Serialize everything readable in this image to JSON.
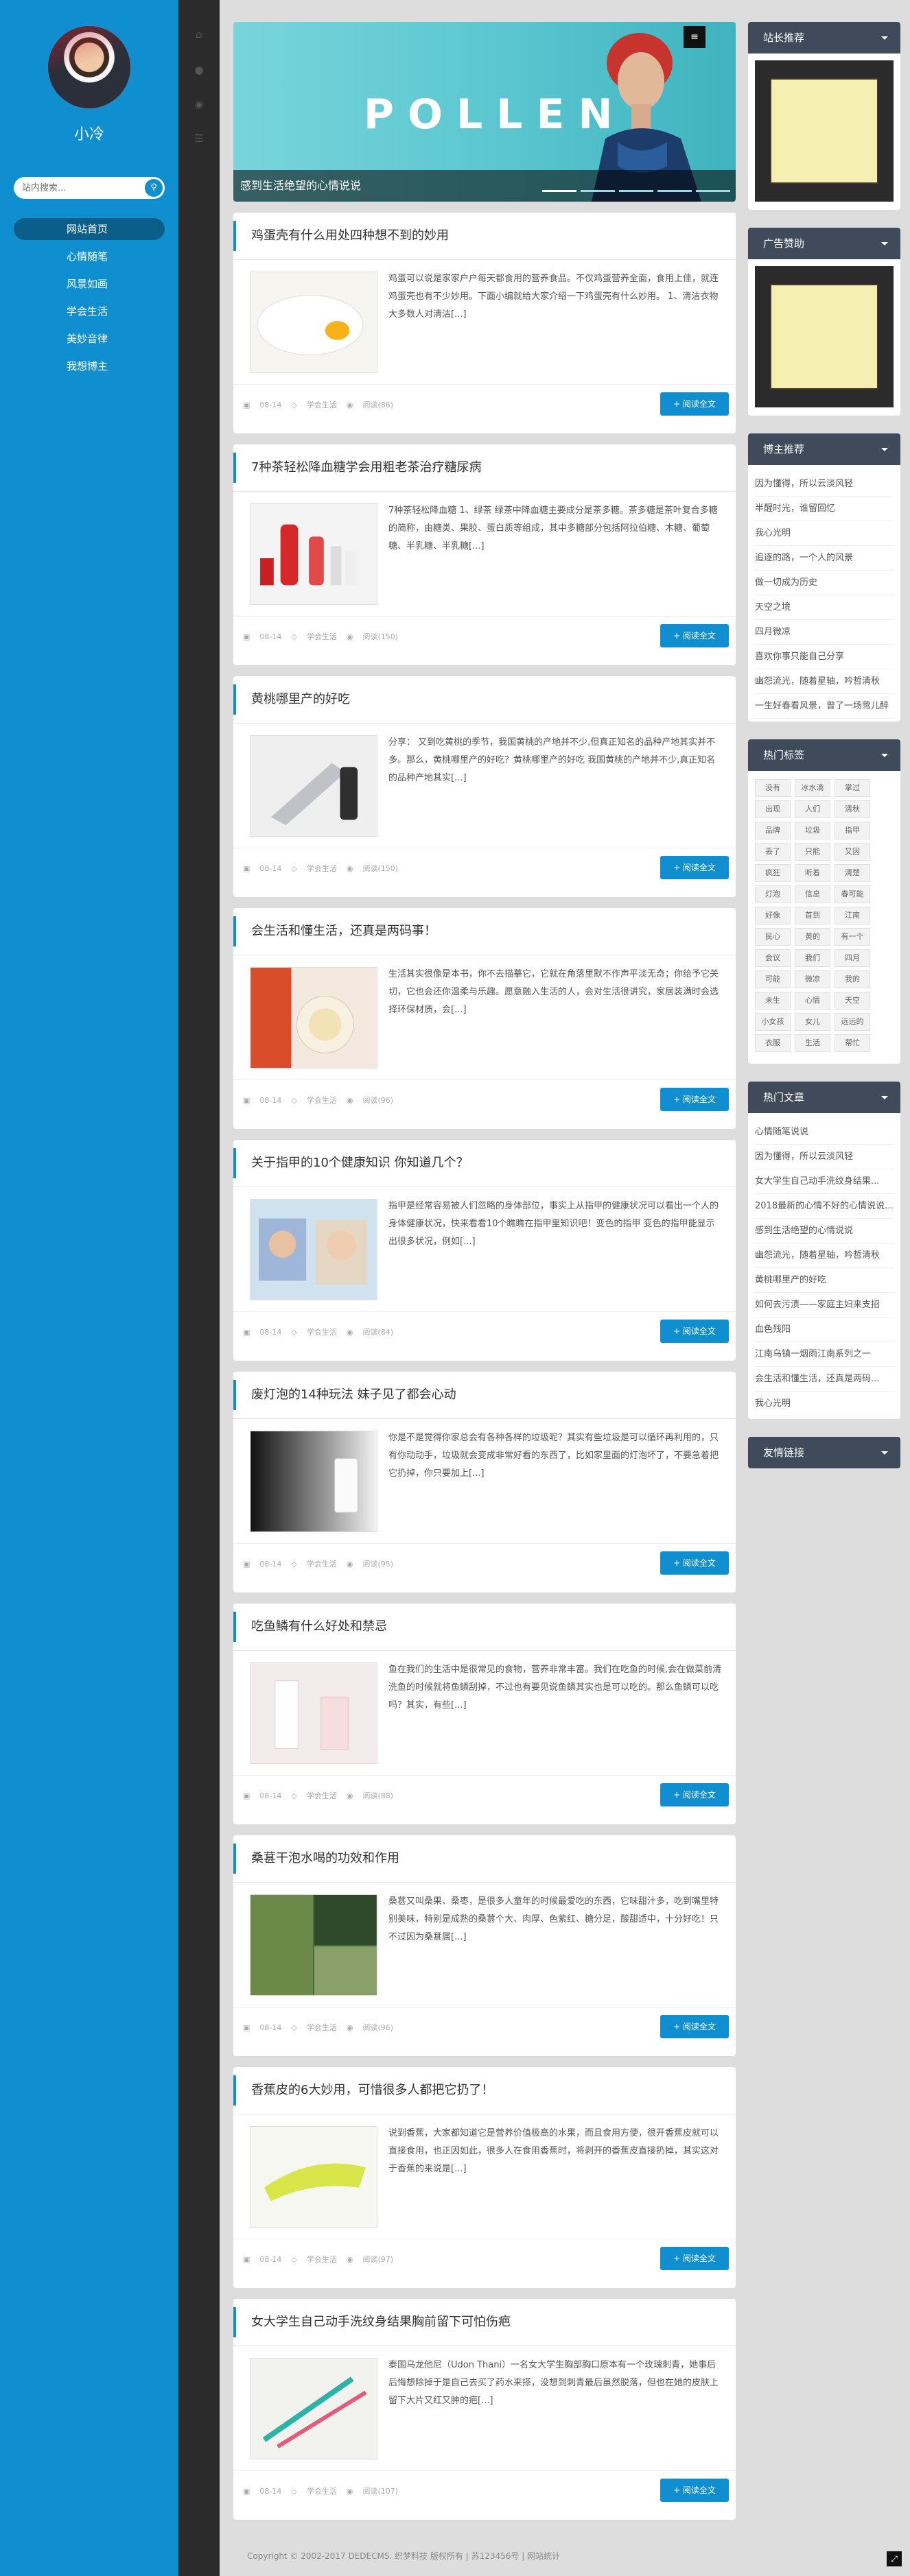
{
  "profile": {
    "name": "小冷"
  },
  "search": {
    "placeholder": "站内搜索..."
  },
  "nav": [
    {
      "label": "网站首页"
    },
    {
      "label": "心情随笔"
    },
    {
      "label": "风景如画"
    },
    {
      "label": "学会生活"
    },
    {
      "label": "美妙音律"
    },
    {
      "label": "我想博主"
    }
  ],
  "banner": {
    "title": "POLLEN",
    "caption": "感到生活绝望的心情说说",
    "menu_icon": "≡"
  },
  "posts": [
    {
      "title": "鸡蛋壳有什么用处四种想不到的妙用",
      "excerpt": "鸡蛋可以说是家家户户每天都食用的营养食品。不仅鸡蛋营养全面，食用上佳，就连鸡蛋壳也有不少妙用。下面小编就给大家介绍一下鸡蛋壳有什么妙用。 1、清洁衣物 大多数人对清洁[...]",
      "date": "08-14",
      "category": "学会生活",
      "views": "阅读(86)",
      "button": "+ 阅读全文"
    },
    {
      "title": "7种茶轻松降血糖学会用粗老茶治疗糖尿病",
      "excerpt": "7种茶轻松降血糖 1、绿茶 绿茶中降血糖主要成分是茶多糖。茶多糖是茶叶复合多糖的简称，由糖类、果胶、蛋白质等组成，其中多糖部分包括阿拉伯糖、木糖、葡萄糖、半乳糖、半乳糖[...]",
      "date": "08-14",
      "category": "学会生活",
      "views": "阅读(150)",
      "button": "+ 阅读全文"
    },
    {
      "title": "黄桃哪里产的好吃",
      "excerpt": "分享： 又到吃黄桃的季节，我国黄桃的产地并不少,但真正知名的品种产地其实并不多。那么，黄桃哪里产的好吃？黄桃哪里产的好吃 我国黄桃的产地并不少,真正知名的品种产地其实[...]",
      "date": "08-14",
      "category": "学会生活",
      "views": "阅读(150)",
      "button": "+ 阅读全文"
    },
    {
      "title": "会生活和懂生活，还真是两码事！",
      "excerpt": "生活其实很像是本书，你不去描摹它，它就在角落里默不作声平淡无奇；你给予它关切，它也会还你温柔与乐趣。愿意融入生活的人，会对生活很讲究，家居装满时会选择环保材质，会[...]",
      "date": "08-14",
      "category": "学会生活",
      "views": "阅读(96)",
      "button": "+ 阅读全文"
    },
    {
      "title": "关于指甲的10个健康知识 你知道几个？",
      "excerpt": "指甲是经常容易被人们忽略的身体部位，事实上从指甲的健康状况可以看出一个人的身体健康状况，快来看看10个瞧瞧在指甲里知识吧！变色的指甲 变色的指甲能显示出很多状况，例如[...]",
      "date": "08-14",
      "category": "学会生活",
      "views": "阅读(84)",
      "button": "+ 阅读全文"
    },
    {
      "title": "废灯泡的14种玩法 妹子见了都会心动",
      "excerpt": "你是不是觉得你家总会有各种各样的垃圾呢？其实有些垃圾是可以循环再利用的，只有你动动手，垃圾就会变成非常好看的东西了，比如家里面的灯泡坏了，不要急着把它扔掉，你只要加上[...]",
      "date": "08-14",
      "category": "学会生活",
      "views": "阅读(95)",
      "button": "+ 阅读全文"
    },
    {
      "title": "吃鱼鳞有什么好处和禁忌",
      "excerpt": "鱼在我们的生活中是很常见的食物，营养非常丰富。我们在吃鱼的时候,会在做菜前清洗鱼的时候就将鱼鳞刮掉，不过也有要见说鱼鳞其实也是可以吃的。那么鱼鳞可以吃吗？其实，有些[...]",
      "date": "08-14",
      "category": "学会生活",
      "views": "阅读(88)",
      "button": "+ 阅读全文"
    },
    {
      "title": "桑葚干泡水喝的功效和作用",
      "excerpt": "桑葚又叫桑果、桑枣，是很多人童年的时候最爱吃的东西，它味甜汁多，吃到嘴里特别美味，特别是成熟的桑葚个大、肉厚、色紫红、糖分足，酸甜适中，十分好吃！只不过因为桑葚属[...]",
      "date": "08-14",
      "category": "学会生活",
      "views": "阅读(96)",
      "button": "+ 阅读全文"
    },
    {
      "title": "香蕉皮的6大妙用，可惜很多人都把它扔了！",
      "excerpt": "说到香蕉，大家都知道它是营养价值极高的水果，而且食用方便，很开香蕉皮就可以直接食用，也正因如此，很多人在食用香蕉时，将剥开的香蕉皮直接扔掉，其实这对于香蕉的来说是[...]",
      "date": "08-14",
      "category": "学会生活",
      "views": "阅读(97)",
      "button": "+ 阅读全文"
    },
    {
      "title": "女大学生自己动手洗纹身结果胸前留下可怕伤疤",
      "excerpt": "泰国乌龙他尼（Udon Thani）一名女大学生胸部胸口原本有一个玫瑰刺青，她事后后悔想除掉于是自己去买了药水来搽，没想到刺青最后虽然脱落，但也在她的皮肤上留下大片又红又肿的疤[...]",
      "date": "08-14",
      "category": "学会生活",
      "views": "阅读(107)",
      "button": "+ 阅读全文"
    }
  ],
  "widgets": {
    "recommend_title": "站长推荐",
    "ad_title": "广告赞助",
    "blogger_title": "博主推荐",
    "blogger_links": [
      "因为懂得，所以云淡风轻",
      "半醒时光，谁留回忆",
      "我心光明",
      "追逐的路，一个人的风景",
      "做一切成为历史",
      "天空之境",
      "四月微凉",
      "喜欢你事只能自己分享",
      "幽怨流光，随着星轴，吟哲清秋",
      "一生好春看风景，曾了一场莺儿醉"
    ],
    "tags_title": "热门标签",
    "tags": [
      "没有",
      "冰水滴",
      "掌过",
      "出现",
      "人们",
      "清秋",
      "品牌",
      "垃圾",
      "指甲",
      "丢了",
      "只能",
      "又因",
      "疯狂",
      "听着",
      "清楚",
      "灯泡",
      "信息",
      "春可能",
      "好像",
      "首到",
      "江南",
      "民心",
      "黄的",
      "有一个",
      "会议",
      "我们",
      "四月",
      "可能",
      "微凉",
      "我的",
      "未生",
      "心情",
      "天空",
      "小女孩",
      "女儿",
      "远远的",
      "衣服",
      "生活",
      "帮忙"
    ],
    "hot_title": "热门文章",
    "hot_links": [
      "心情随笔说说",
      "因为懂得，所以云淡风轻",
      "女大学生自己动手洗纹身结果...",
      "2018最新的心情不好的心情说说...",
      "感到生活绝望的心情说说",
      "幽怨流光，随着星轴，吟哲清秋",
      "黄桃哪里产的好吃",
      "如何去污渍——家庭主妇来支招",
      "血色残阳",
      "江南乌镇一烟雨江南系列之一",
      "会生活和懂生活，还真是两码...",
      "我心光明"
    ],
    "friend_title": "友情链接"
  },
  "footer": {
    "text": "Copyright © 2002-2017 DEDECMS. 织梦科技 版权所有 | 苏123456号 | 网站统计"
  },
  "colors": {
    "accent": "#0f8fd0",
    "sidebar": "#0f8fd0",
    "rail": "#2b2b2b",
    "widget_head": "#3f4b5b"
  }
}
